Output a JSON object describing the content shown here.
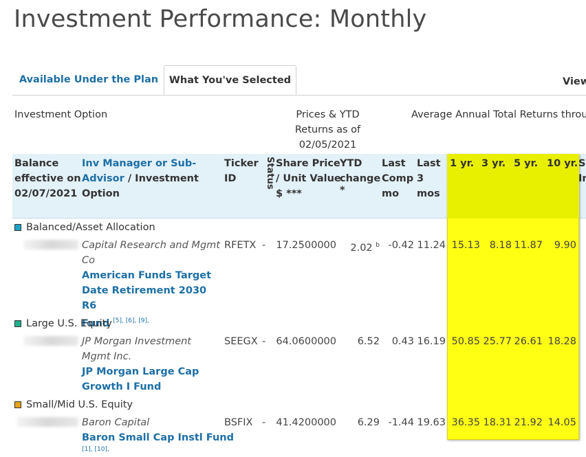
{
  "page": {
    "title": "Investment Performance: Monthly"
  },
  "tabs": [
    {
      "label": "Available Under the Plan"
    },
    {
      "label": "What You've Selected"
    }
  ],
  "view_label": "View",
  "group_headers": {
    "investment_option": "Investment Option",
    "prices_line1": "Prices & YTD",
    "prices_line2": "Returns as of",
    "prices_line3": "02/05/2021",
    "avg_annual": "Average Annual Total Returns throu"
  },
  "columns": {
    "balance_l1": "Balance",
    "balance_l2": "effective on",
    "balance_l3": "02/07/2021",
    "mgr_l1": "Inv Manager or Sub-",
    "mgr_l2a": "Advisor",
    "mgr_l2b": " / Investment",
    "mgr_l3": "Option",
    "ticker_l1": "Ticker",
    "ticker_l2": "ID",
    "status": "Status",
    "share_l1": "Share Price",
    "share_l2": "/ Unit Value",
    "share_l3": "$ ***",
    "ytd_l1": "YTD",
    "ytd_l2": "change",
    "ytd_l3": "*",
    "lastcomp_l1": "Last",
    "lastcomp_l2": "Comp",
    "lastcomp_l3": "mo",
    "last3_l1": "Last",
    "last3_l2": "3",
    "last3_l3": "mos",
    "yr1": "1 yr.",
    "yr3": "3 yr.",
    "yr5": "5 yr.",
    "yr10": "10 yr.",
    "si_l1": "Si",
    "si_l2": "In"
  },
  "categories": [
    {
      "name": "Balanced/Asset Allocation",
      "color": "#1aa3c7",
      "manager_l1": "Capital Research and Mgmt",
      "manager_l2": "Co",
      "fund_l1": "American Funds Target",
      "fund_l2": "Date Retirement 2030 R6",
      "fund_l3": "Fund",
      "fund_notes": "[5], [6], [9],",
      "ticker": "RFETX",
      "status": "-",
      "share_price": "17.2500000",
      "ytd": "2.02",
      "ytd_note": "b",
      "last_comp": "-0.42",
      "last3": "11.24",
      "yr1": "15.13",
      "yr3": "8.18",
      "yr5": "11.87",
      "yr10": "9.90"
    },
    {
      "name": "Large U.S. Equity",
      "color": "#1fae8c",
      "manager_l1": "JP Morgan Investment",
      "manager_l2": "Mgmt Inc.",
      "fund_l1": "JP Morgan Large Cap",
      "fund_l2": "Growth I Fund",
      "ticker": "SEEGX",
      "status": "-",
      "share_price": "64.0600000",
      "ytd": "6.52",
      "last_comp": "0.43",
      "last3": "16.19",
      "yr1": "50.85",
      "yr3": "25.77",
      "yr5": "26.61",
      "yr10": "18.28"
    },
    {
      "name": "Small/Mid U.S. Equity",
      "color": "#e8a317",
      "manager_l1": "Baron Capital",
      "fund_l1": "Baron Small Cap Instl Fund",
      "fund_notes": "[1], [10],",
      "ticker": "BSFIX",
      "status": "-",
      "share_price": "41.4200000",
      "ytd": "6.29",
      "last_comp": "-1.44",
      "last3": "19.63",
      "yr1": "36.35",
      "yr3": "18.31",
      "yr5": "21.92",
      "yr10": "14.05"
    }
  ]
}
